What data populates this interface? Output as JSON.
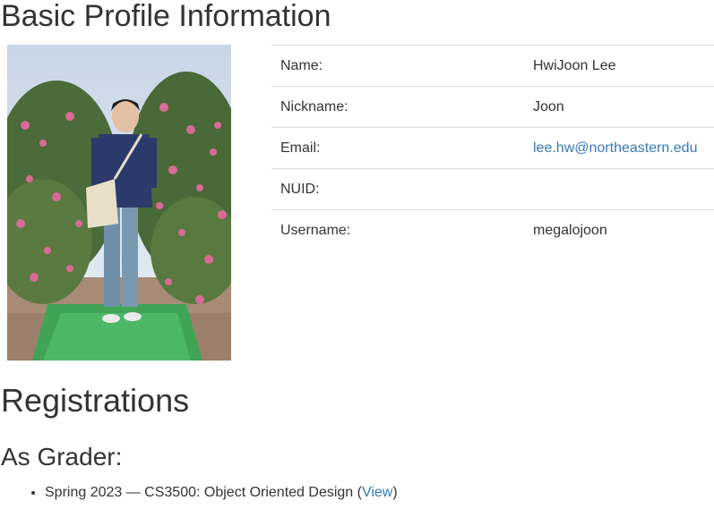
{
  "profile": {
    "heading": "Basic Profile Information",
    "photo_alt": "profile-photo",
    "fields": {
      "name_label": "Name:",
      "name_value": "HwiJoon Lee",
      "nickname_label": "Nickname:",
      "nickname_value": "Joon",
      "email_label": "Email:",
      "email_value": "lee.hw@northeastern.edu",
      "nuid_label": "NUID:",
      "nuid_value": "",
      "username_label": "Username:",
      "username_value": "megalojoon"
    }
  },
  "registrations": {
    "heading": "Registrations",
    "grader_heading": "As Grader:",
    "items": [
      {
        "text": "Spring 2023 — CS3500: Object Oriented Design (",
        "link_label": "View",
        "suffix": ")"
      }
    ]
  },
  "colors": {
    "link": "#337ab7",
    "text": "#333333",
    "row_border": "#dddddd"
  }
}
